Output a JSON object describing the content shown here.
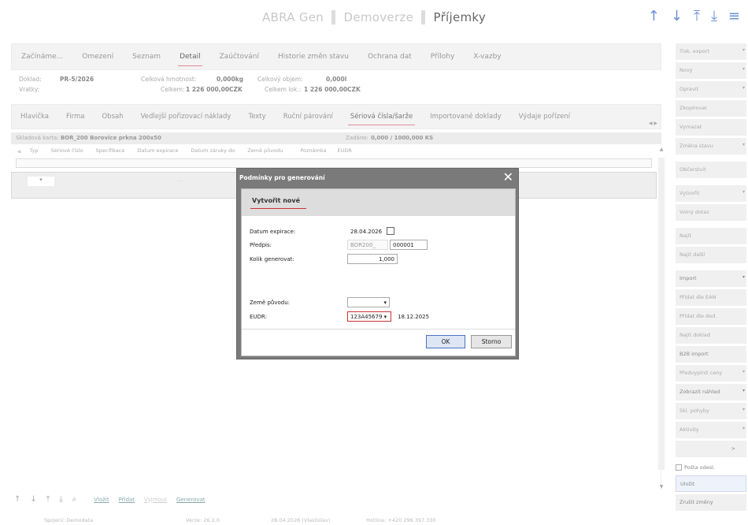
{
  "app": {
    "name": "ABRA Gen",
    "edition": "Demoverze",
    "module": "Příjemky"
  },
  "nav_icons": [
    "arrow-up-icon",
    "arrow-down-icon",
    "arrow-top-icon",
    "arrow-bottom-icon",
    "menu-icon"
  ],
  "topnav": {
    "items": [
      "Začínáme...",
      "Omezení",
      "Seznam",
      "Detail",
      "Zaúčtování",
      "Historie změn stavu",
      "Ochrana dat",
      "Přílohy",
      "X-vazby"
    ]
  },
  "info": {
    "doklad_label": "Doklad:",
    "doklad_value": "PR-5/2026",
    "vratky_label": "Vratky:",
    "hmotnost_label": "Celková hmotnost:",
    "hmotnost_value": "0,000kg",
    "objem_label": "Celkový objem:",
    "objem_value": "0,000l",
    "celkem_label": "Celkem:",
    "celkem_value": "1 226 000,00CZK",
    "celkem_lok_label": "Celkem lok.:",
    "celkem_lok_value": "1 226 000,00CZK"
  },
  "subnav": {
    "items": [
      "Hlavička",
      "Firma",
      "Obsah",
      "Vedlejší pořizovací náklady",
      "Texty",
      "Ruční párování",
      "Sériová čísla/šarže",
      "Importované doklady",
      "Výdaje pořízení"
    ]
  },
  "skladova": {
    "label": "Skladová karta:",
    "value": "BOR_200 Borovice prkna 200x50",
    "zadano_label": "Zadáno:",
    "zadano_value": "0,000 / 1000,000 KS"
  },
  "grid": {
    "columns": [
      "Typ",
      "Sériové číslo",
      "Specifikace",
      "Datum expirace",
      "Datum záruky do",
      "Země původu",
      "Poznámka",
      "EUDR"
    ],
    "row_dash": "- -"
  },
  "bottom": {
    "links": [
      "Vložit",
      "Přidat",
      "Vyjmout",
      "Generovat"
    ]
  },
  "status": {
    "spojeni": "Spojení: Demodata",
    "verze": "Verze: 26.2.0",
    "datum": "28.04.2026 (Vlastislav)",
    "hotline": "Hotline: +420 296 397 330"
  },
  "sidebar": {
    "buttons": [
      {
        "label": "Tisk, export",
        "dd": true
      },
      {
        "label": "Nový",
        "dd": true
      },
      {
        "label": "Opravit",
        "dd": true
      },
      {
        "label": "Zkopírovat",
        "dd": false
      },
      {
        "label": "Vymazat",
        "dd": false
      },
      {
        "label": "Změna stavu",
        "dd": true
      },
      {
        "label": "Občerstvit",
        "dd": false
      },
      {
        "label": "Vytvořit",
        "dd": true
      },
      {
        "label": "Volný dotaz",
        "dd": false
      },
      {
        "label": "Najít",
        "dd": false
      },
      {
        "label": "Najít další",
        "dd": false
      },
      {
        "label": "Import",
        "dd": true
      },
      {
        "label": "Přidat dle EAN",
        "dd": false
      },
      {
        "label": "Přidat dle dod.",
        "dd": false
      },
      {
        "label": "Najít doklad",
        "dd": false
      },
      {
        "label": "B2B import",
        "dd": false
      },
      {
        "label": "Předvyplnit ceny",
        "dd": true
      },
      {
        "label": "Zobrazit náhled",
        "dd": true
      },
      {
        "label": "Skl. pohyby",
        "dd": true
      },
      {
        "label": "Aktivity",
        "dd": true
      }
    ],
    "more": ">",
    "posta_label": "Pošta odesl.",
    "save": "Uložit",
    "cancel": "Zrušit změny"
  },
  "dialog": {
    "title": "Podmínky pro generování",
    "tab": "Vytvořit nové",
    "datum_label": "Datum expirace:",
    "datum_value": "28.04.2026",
    "predpis_label": "Předpis:",
    "predpis_prefix": "BOR200_",
    "predpis_number": "000001",
    "kolik_label": "Kolik generovat:",
    "kolik_value": "1,000",
    "zeme_label": "Země původu:",
    "eudr_label": "EUDR:",
    "eudr_value": "123A45679",
    "eudr_date": "18.12.2025",
    "ok": "OK",
    "storno": "Storno"
  }
}
